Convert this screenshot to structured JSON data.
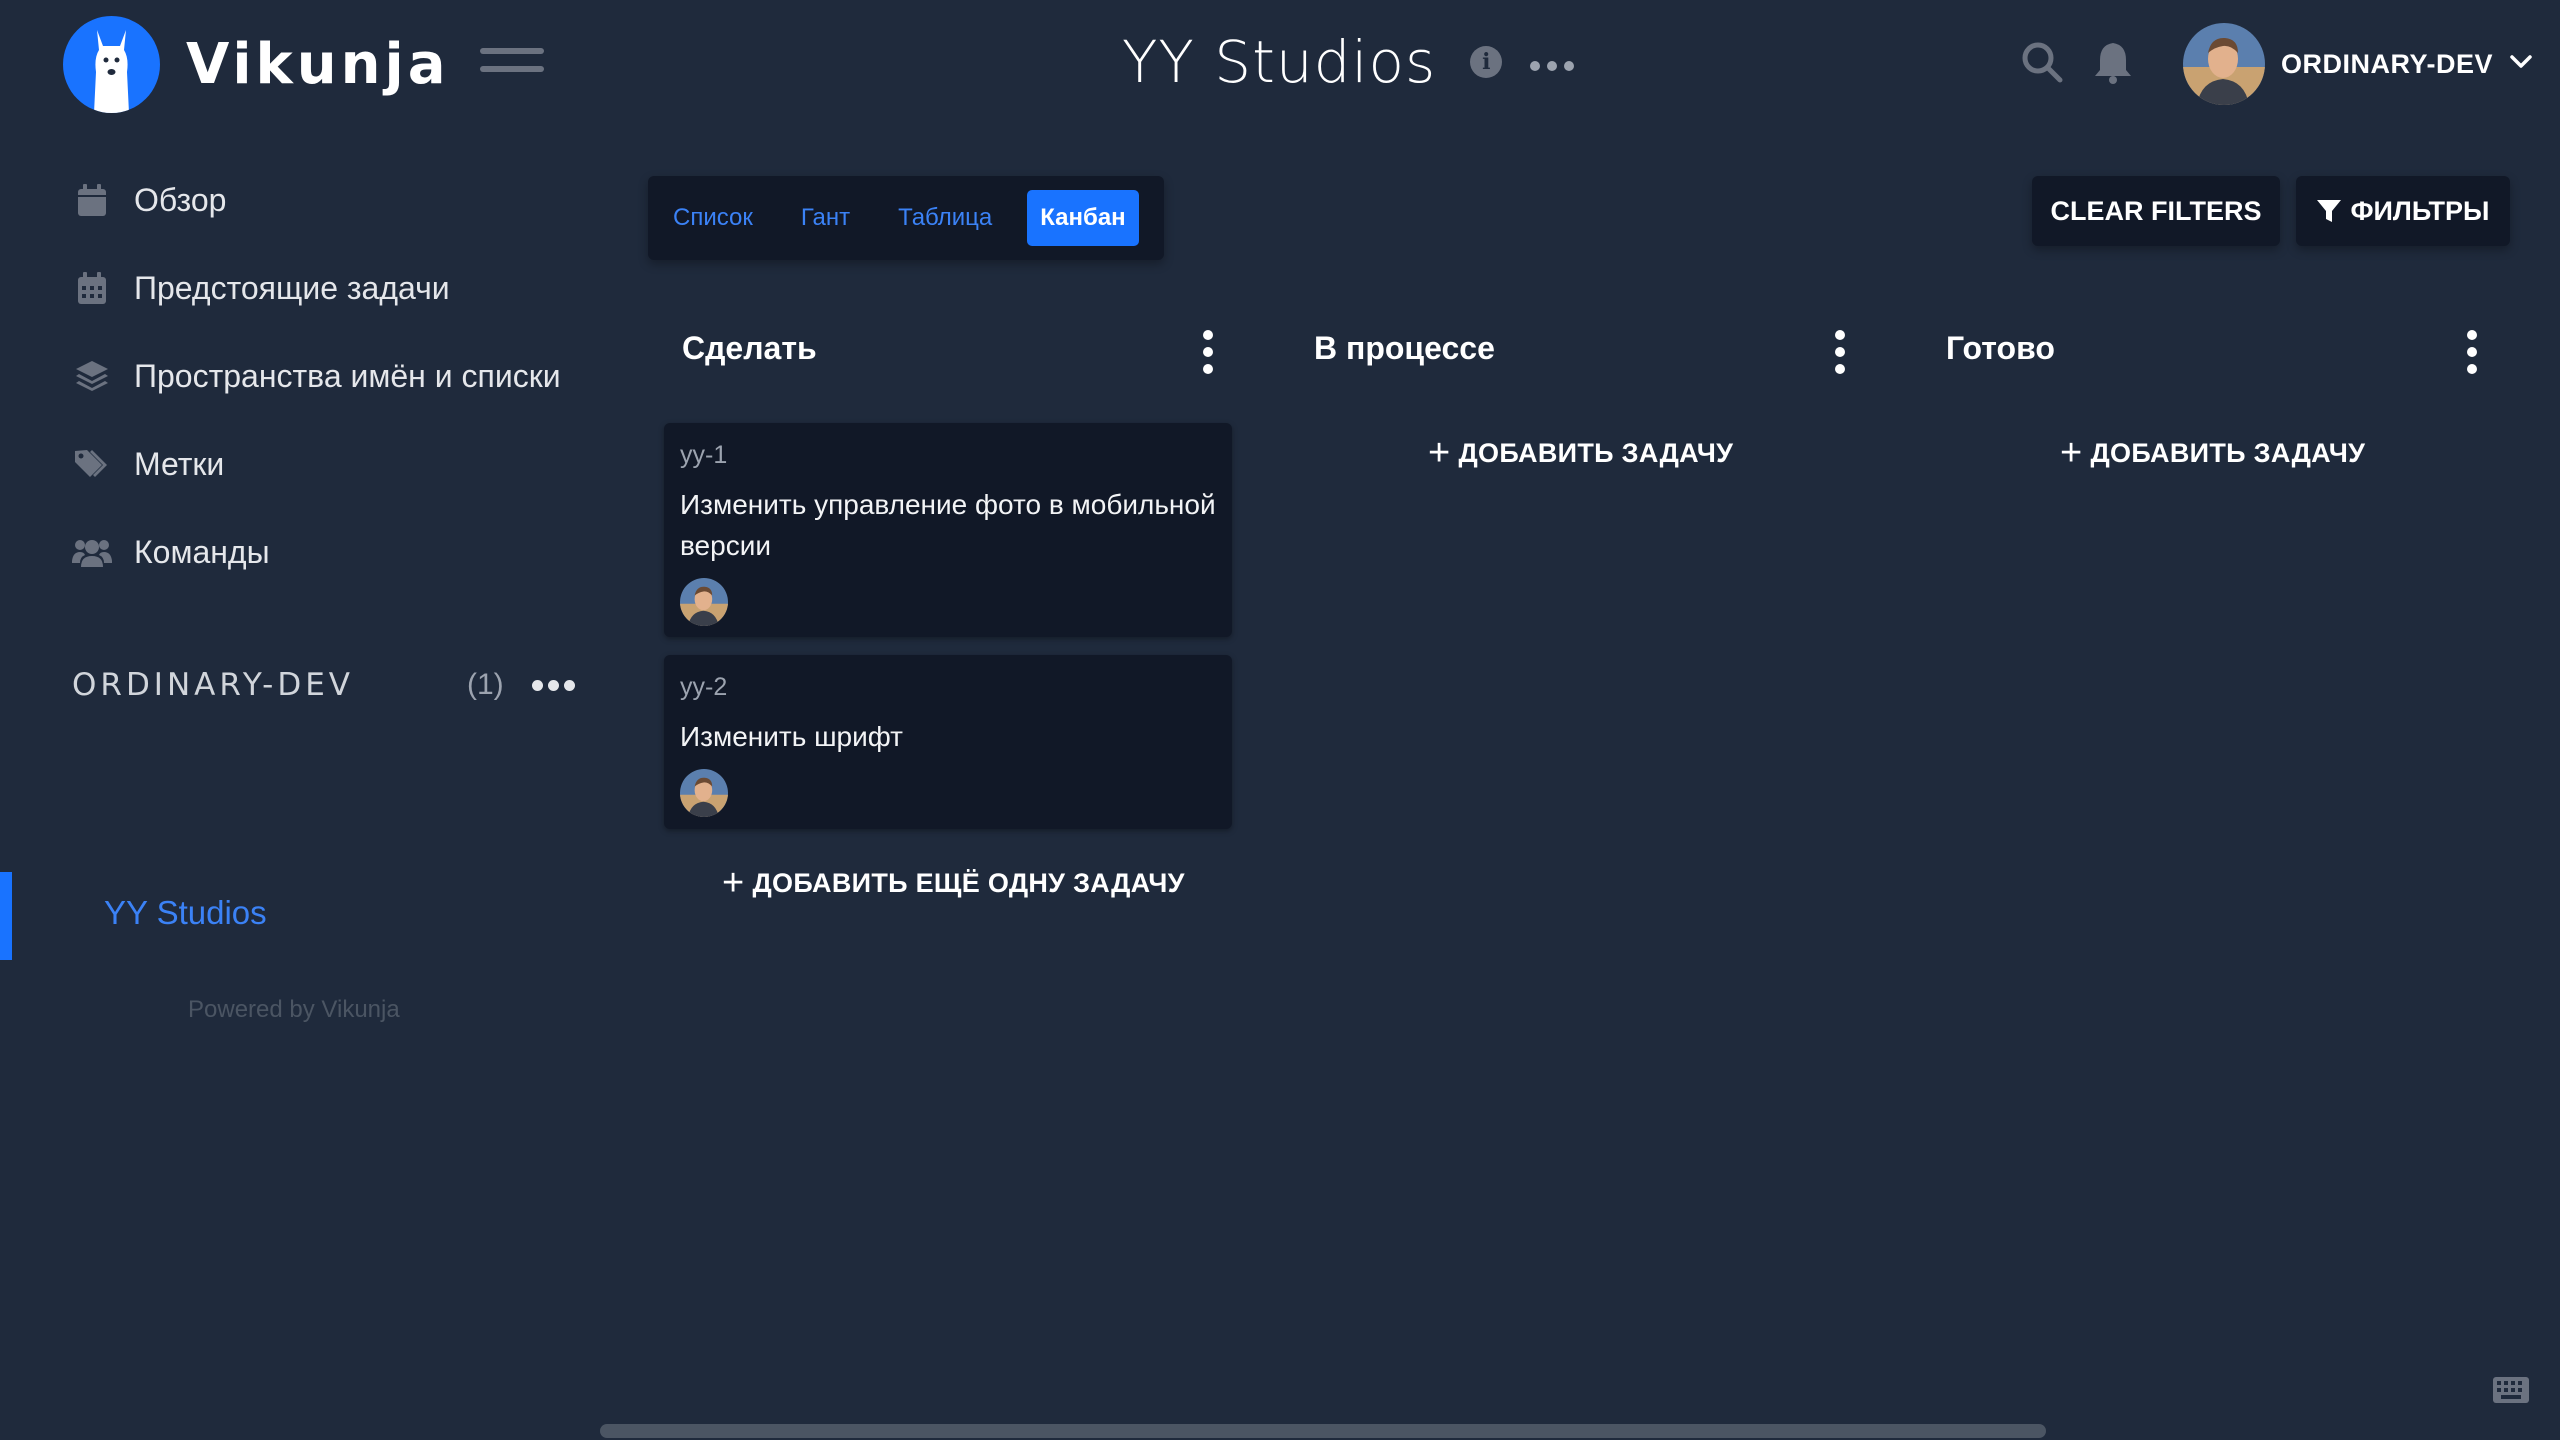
{
  "app": {
    "name": "Vikunja"
  },
  "header": {
    "project_title": "YY Studios",
    "user_name": "ORDINARY-DEV"
  },
  "sidebar": {
    "items": [
      {
        "label": "Обзор",
        "icon": "calendar-icon"
      },
      {
        "label": "Предстоящие задачи",
        "icon": "calendar-grid-icon"
      },
      {
        "label": "Пространства имён и списки",
        "icon": "layers-icon"
      },
      {
        "label": "Метки",
        "icon": "tags-icon"
      },
      {
        "label": "Команды",
        "icon": "users-icon"
      }
    ],
    "namespace": {
      "title": "ORDINARY-DEV",
      "count": "(1)"
    },
    "projects": [
      {
        "label": "YY Studios"
      }
    ],
    "powered_by": "Powered by Vikunja"
  },
  "views": {
    "tabs": [
      {
        "label": "Список"
      },
      {
        "label": "Гант"
      },
      {
        "label": "Таблица"
      },
      {
        "label": "Канбан"
      }
    ],
    "active": "Канбан"
  },
  "toolbar": {
    "clear_filters": "CLEAR FILTERS",
    "filters": "ФИЛЬТРЫ"
  },
  "buckets": [
    {
      "title": "Сделать",
      "tasks": [
        {
          "id": "yy-1",
          "title": "Изменить управление фото в мобильной версии"
        },
        {
          "id": "yy-2",
          "title": "Изменить шрифт"
        }
      ],
      "add_label": "ДОБАВИТЬ ЕЩЁ ОДНУ ЗАДАЧУ"
    },
    {
      "title": "В процессе",
      "tasks": [],
      "add_label": "ДОБАВИТЬ ЗАДАЧУ"
    },
    {
      "title": "Готово",
      "tasks": [],
      "add_label": "ДОБАВИТЬ ЗАДАЧУ"
    }
  ],
  "colors": {
    "background": "#1f2a3c",
    "card": "#111827",
    "accent": "#1973ff",
    "link": "#3b82f6"
  }
}
